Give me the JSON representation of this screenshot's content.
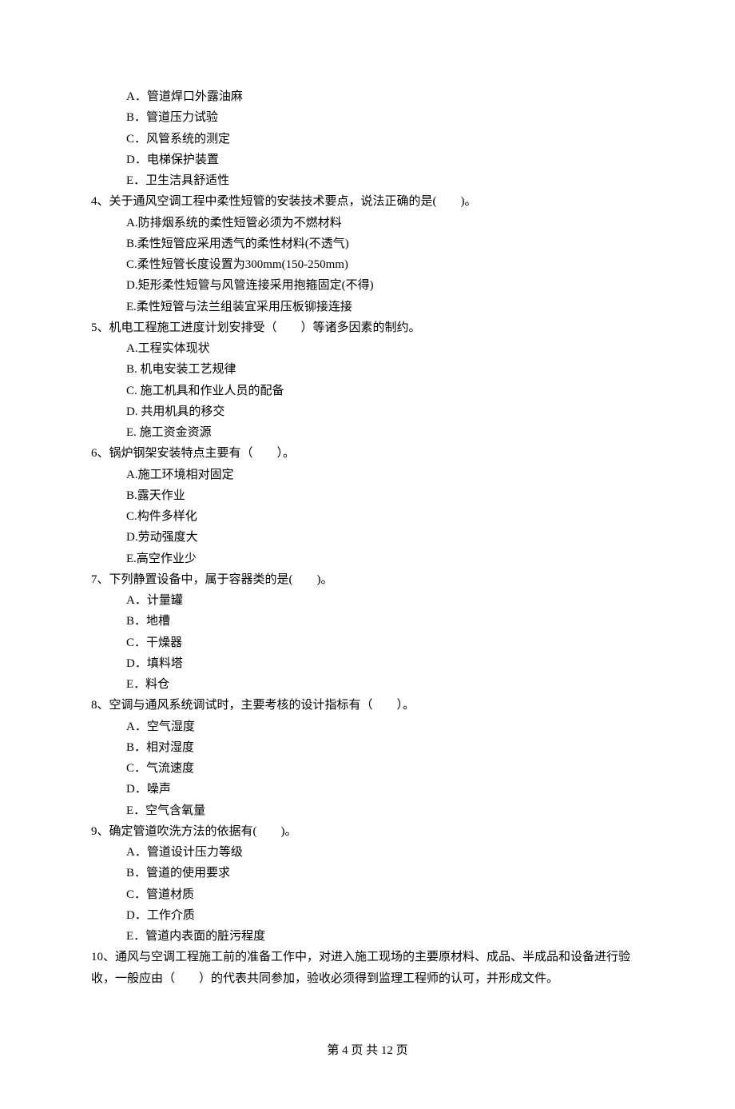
{
  "q3_options": {
    "A": "A．管道焊口外露油麻",
    "B": "B．管道压力试验",
    "C": "C．风管系统的测定",
    "D": "D．电梯保护装置",
    "E": "E．卫生洁具舒适性"
  },
  "q4": {
    "stem": "4、关于通风空调工程中柔性短管的安装技术要点，说法正确的是(　　)。",
    "A": "A.防排烟系统的柔性短管必须为不燃材料",
    "B": "B.柔性短管应采用透气的柔性材料(不透气)",
    "C": "C.柔性短管长度设置为300mm(150-250mm)",
    "D": "D.矩形柔性短管与风管连接采用抱箍固定(不得)",
    "E": "E.柔性短管与法兰组装宜采用压板铆接连接"
  },
  "q5": {
    "stem": "5、机电工程施工进度计划安排受（　　）等诸多因素的制约。",
    "A": "A.工程实体现状",
    "B": "B. 机电安装工艺规律",
    "C": "C. 施工机具和作业人员的配备",
    "D": "D. 共用机具的移交",
    "E": "E. 施工资金资源"
  },
  "q6": {
    "stem": "6、锅炉钢架安装特点主要有（　　）。",
    "A": "A.施工环境相对固定",
    "B": "B.露天作业",
    "C": "C.构件多样化",
    "D": "D.劳动强度大",
    "E": "E.高空作业少"
  },
  "q7": {
    "stem": "7、下列静置设备中，属于容器类的是(　　)。",
    "A": "A．计量罐",
    "B": "B．地槽",
    "C": "C．干燥器",
    "D": "D．填料塔",
    "E": "E．料仓"
  },
  "q8": {
    "stem": "8、空调与通风系统调试时，主要考核的设计指标有（　　）。",
    "A": "A．空气湿度",
    "B": "B．相对湿度",
    "C": "C．气流速度",
    "D": "D．噪声",
    "E": "E．空气含氧量"
  },
  "q9": {
    "stem": "9、确定管道吹洗方法的依据有(　　)。",
    "A": "A．管道设计压力等级",
    "B": "B．管道的使用要求",
    "C": "C．管道材质",
    "D": "D．工作介质",
    "E": "E．管道内表面的脏污程度"
  },
  "q10": {
    "stem": "10、通风与空调工程施工前的准备工作中，对进入施工现场的主要原材料、成品、半成品和设备进行验收，一般应由（　　）的代表共同参加，验收必须得到监理工程师的认可，并形成文件。"
  },
  "footer": "第 4 页 共 12 页"
}
